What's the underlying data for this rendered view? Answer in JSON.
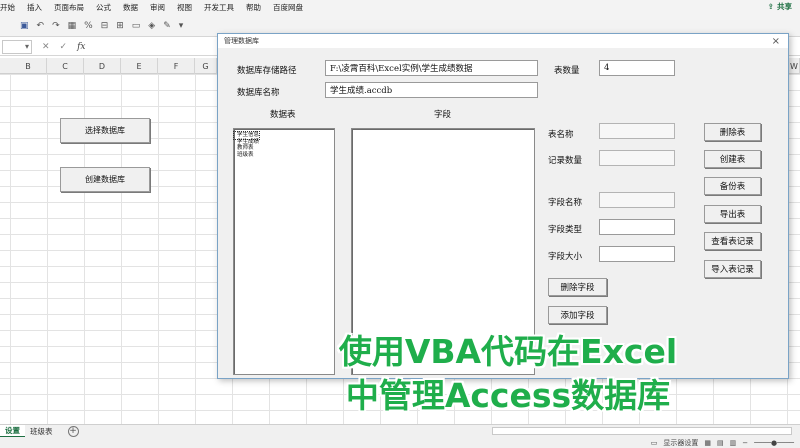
{
  "ribbon": {
    "menu": [
      "开始",
      "插入",
      "页面布局",
      "公式",
      "数据",
      "审阅",
      "视图",
      "开发工具",
      "帮助",
      "百度网盘"
    ],
    "share": "共享"
  },
  "formula_bar": {
    "name_box": "",
    "fx": "fx"
  },
  "columns": [
    "B",
    "C",
    "D",
    "E",
    "F",
    "G",
    "W"
  ],
  "sheet_buttons": {
    "select_db": "选择数据库",
    "create_db": "创建数据库"
  },
  "sheet_tabs": [
    "设置",
    "班级表"
  ],
  "status": {
    "display_settings": "显示器设置"
  },
  "dialog": {
    "title": "管理数据库",
    "db_path_label": "数据库存储路径",
    "db_path_value": "F:\\凌霄百科\\Excel实例\\学生成绩数据",
    "db_name_label": "数据库名称",
    "db_name_value": "学生成绩.accdb",
    "table_count_label": "表数量",
    "table_count_value": "4",
    "tables_header": "数据表",
    "fields_header": "字段",
    "tables": [
      "学生信息",
      "学生成绩",
      "教师表",
      "班级表"
    ],
    "table_name_label": "表名称",
    "record_count_label": "记录数量",
    "field_name_label": "字段名称",
    "field_type_label": "字段类型",
    "field_size_label": "字段大小",
    "buttons": {
      "delete_table": "删除表",
      "create_table": "创建表",
      "backup_table": "备份表",
      "export_table": "导出表",
      "view_records": "查看表记录",
      "import_records": "导入表记录",
      "delete_field": "删除字段",
      "add_field": "添加字段"
    }
  },
  "caption": {
    "line1": "使用VBA代码在Excel",
    "line2": "中管理Access数据库"
  }
}
